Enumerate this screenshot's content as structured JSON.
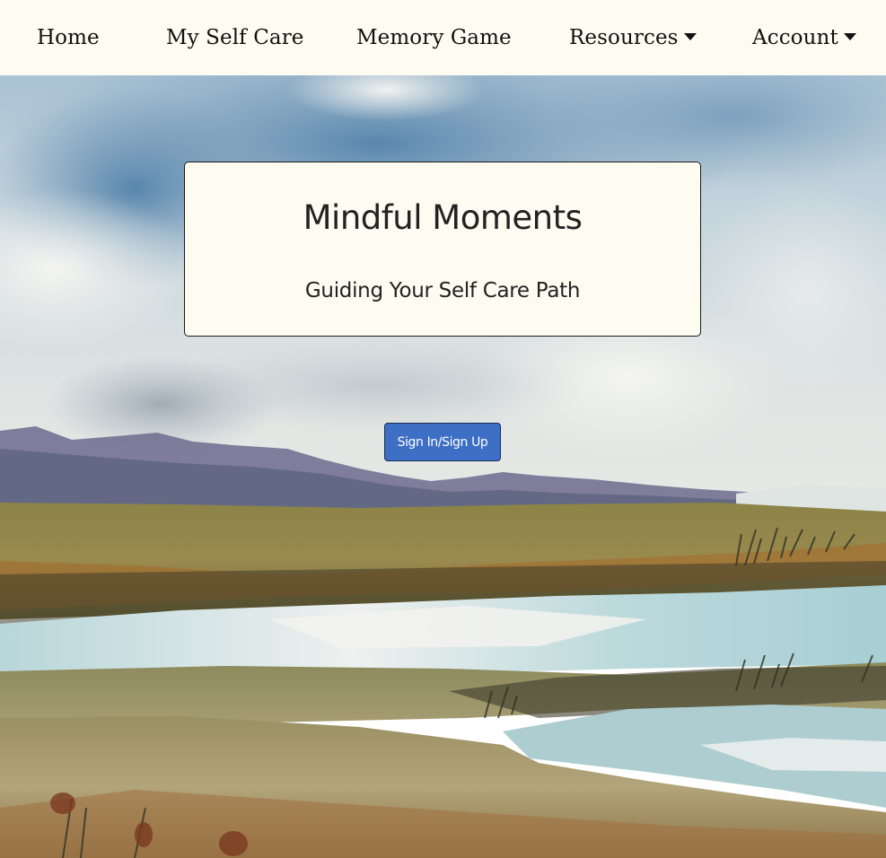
{
  "nav": {
    "home": "Home",
    "self_care": "My Self Care",
    "memory_game": "Memory Game",
    "resources": "Resources",
    "account": "Account"
  },
  "hero": {
    "title": "Mindful Moments",
    "subtitle": "Guiding Your Self Care Path"
  },
  "auth": {
    "signin_label": "Sign In/Sign Up"
  },
  "colors": {
    "nav_background": "#fefbf0",
    "card_background": "#fefbf0",
    "button": "#3d6fc4",
    "text": "#222222"
  },
  "icons": {
    "dropdown": "caret-down-icon"
  }
}
